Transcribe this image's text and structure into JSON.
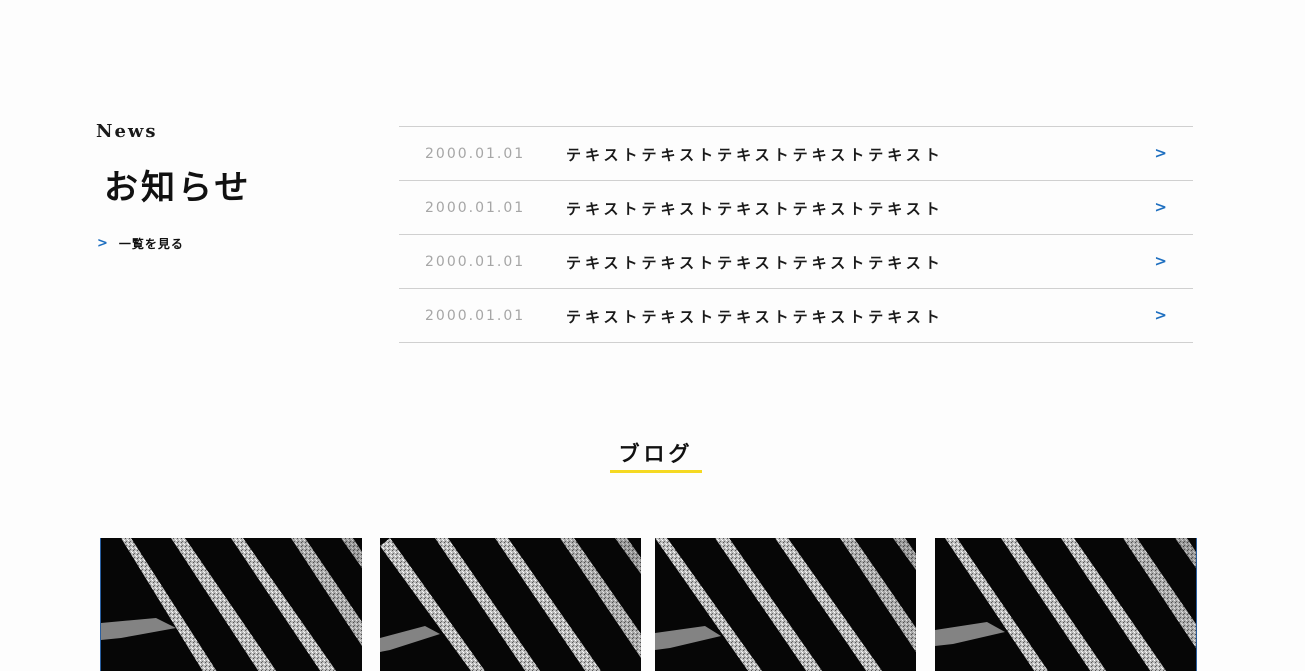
{
  "news": {
    "label_en": "News",
    "label_ja": "お知らせ",
    "view_all": {
      "arrow": ">",
      "label": "一覧を見る"
    },
    "items": [
      {
        "date": "2000.01.01",
        "title": "テキストテキストテキストテキストテキスト",
        "arrow": ">"
      },
      {
        "date": "2000.01.01",
        "title": "テキストテキストテキストテキストテキスト",
        "arrow": ">"
      },
      {
        "date": "2000.01.01",
        "title": "テキストテキストテキストテキストテキスト",
        "arrow": ">"
      },
      {
        "date": "2000.01.01",
        "title": "テキストテキストテキストテキストテキスト",
        "arrow": ">"
      }
    ]
  },
  "blog": {
    "title": "ブログ",
    "cards": [
      {
        "image": "abstract-stripes-photo"
      },
      {
        "image": "abstract-stripes-photo"
      },
      {
        "image": "abstract-stripes-photo"
      },
      {
        "image": "abstract-stripes-photo"
      }
    ]
  },
  "colors": {
    "accent_blue": "#1e6fc0",
    "underline_yellow": "#f5d922",
    "divider": "#d0d0d0",
    "date_gray": "#a6a6a6"
  }
}
